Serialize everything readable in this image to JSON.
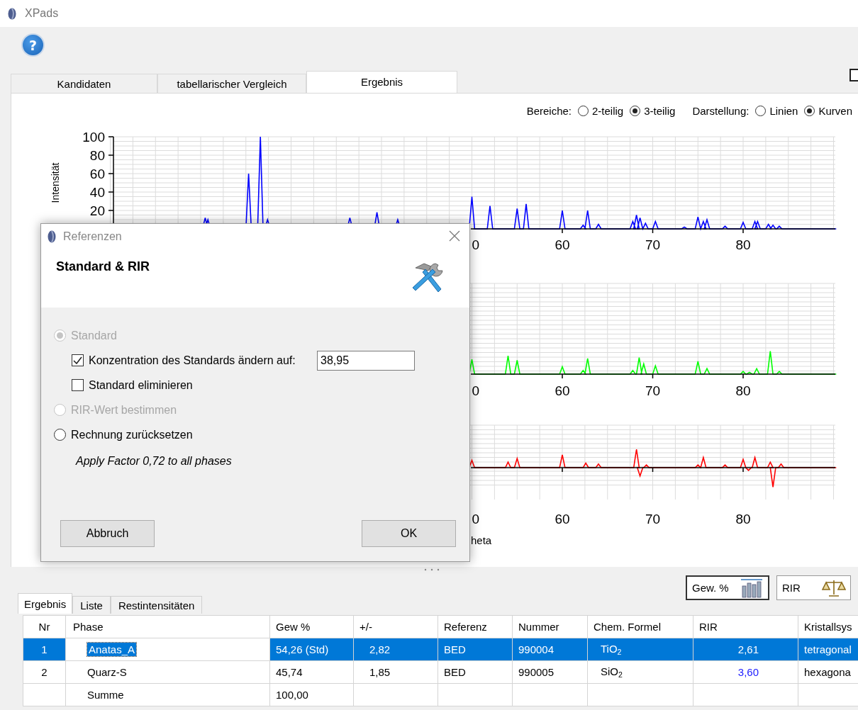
{
  "app": {
    "title": "XPads",
    "help_button": "?"
  },
  "tabs": [
    {
      "label": "Kandidaten",
      "selected": false
    },
    {
      "label": "tabellarischer Vergleich",
      "selected": false
    },
    {
      "label": "Ergebnis",
      "selected": true
    }
  ],
  "chart_options": {
    "groups": [
      {
        "label": "Bereiche:",
        "options": [
          {
            "label": "2-teilig",
            "selected": false
          },
          {
            "label": "3-teilig",
            "selected": true
          }
        ]
      },
      {
        "label": "Darstellung:",
        "options": [
          {
            "label": "Linien",
            "selected": false
          },
          {
            "label": "Kurven",
            "selected": true
          }
        ]
      }
    ]
  },
  "plots": [
    {
      "color": "#0000ff",
      "y_label": "Intensität",
      "y_ticks": [
        "100",
        "80",
        "60",
        "40",
        "20"
      ],
      "x_ticks": [
        "0",
        "60",
        "70",
        "80"
      ]
    },
    {
      "color": "#00ff00",
      "x_ticks": [
        "0",
        "60",
        "70",
        "80"
      ]
    },
    {
      "color": "#ff0000",
      "x_ticks": [
        "0",
        "60",
        "70",
        "80"
      ],
      "x_label": "heta"
    }
  ],
  "dialog": {
    "title": "Referenzen",
    "heading": "Standard & RIR",
    "options": [
      {
        "kind": "radio",
        "label": "Standard",
        "selected": true,
        "disabled": true
      },
      {
        "kind": "checkbox",
        "label": "Konzentration des Standards ändern auf:",
        "checked": true,
        "value": "38,95"
      },
      {
        "kind": "checkbox",
        "label": "Standard eliminieren",
        "checked": false
      },
      {
        "kind": "radio",
        "label": "RIR-Wert bestimmen",
        "selected": false,
        "disabled": true
      },
      {
        "kind": "radio",
        "label": "Rechnung zurücksetzen",
        "selected": false,
        "disabled": false
      },
      {
        "kind": "note",
        "label": "Apply Factor 0,72 to all phases"
      }
    ],
    "buttons": [
      "Abbruch",
      "OK"
    ]
  },
  "mode_buttons": [
    {
      "label": "Gew. %",
      "selected": true
    },
    {
      "label": "RIR",
      "selected": false
    }
  ],
  "result_tabs": [
    {
      "label": "Ergebnis",
      "selected": true
    },
    {
      "label": "Liste",
      "selected": false
    },
    {
      "label": "Restintensitäten",
      "selected": false
    }
  ],
  "table": {
    "columns": [
      "Nr",
      "Phase",
      "Gew %",
      "+/-",
      "Referenz",
      "Nummer",
      "Chem. Formel",
      "RIR",
      "Kristallsys"
    ],
    "rows": [
      {
        "selected": true,
        "cells": [
          "1",
          "Anatas_A",
          "54,26  (Std)",
          "2,82",
          "BED",
          "990004",
          "TiO$_{2}$",
          "2,61",
          "tetragonal"
        ]
      },
      {
        "selected": false,
        "rir_edited": true,
        "cells": [
          "2",
          "Quarz-S",
          "45,74",
          "1,85",
          "BED",
          "990005",
          "SiO$_{2}$",
          "3,60",
          "hexagona"
        ]
      },
      {
        "selected": false,
        "cells": [
          null,
          "Summe",
          "100,00",
          null,
          null,
          null,
          null,
          null,
          null
        ]
      }
    ]
  }
}
